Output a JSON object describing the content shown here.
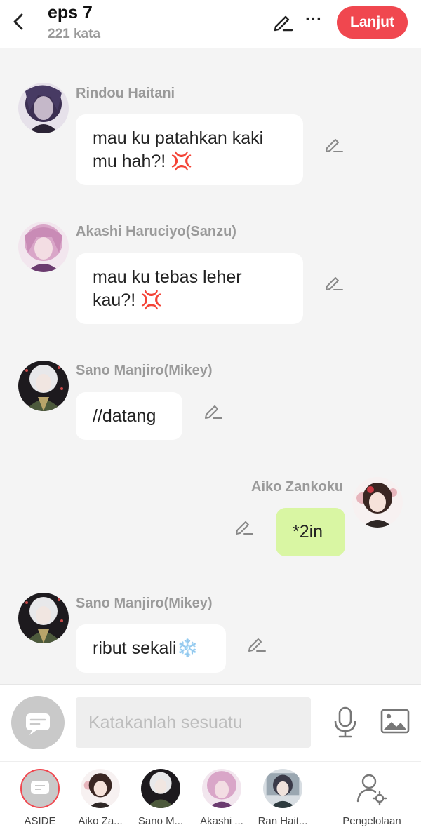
{
  "header": {
    "title": "eps 7",
    "word_count": "221 kata",
    "next_label": "Lanjut",
    "more_label": "···",
    "accent": "#f0474f"
  },
  "messages": [
    {
      "name": "Rindou Haitani",
      "text": "mau ku patahkan kaki mu hah?! 💢",
      "side": "left"
    },
    {
      "name": "Akashi Haruciyo(Sanzu)",
      "text": "mau ku tebas leher kau?! 💢",
      "side": "left"
    },
    {
      "name": "Sano Manjiro(Mikey)",
      "text": "//datang",
      "side": "left"
    },
    {
      "name": "Aiko Zankoku",
      "text": "*2in",
      "side": "right",
      "bubble_color": "#d9f6a3"
    },
    {
      "name": "Sano Manjiro(Mikey)",
      "text": "ribut sekali❄️",
      "side": "left"
    }
  ],
  "input": {
    "placeholder": "Katakanlah sesuatu"
  },
  "characters": [
    {
      "label": "ASIDE"
    },
    {
      "label": "Aiko Za..."
    },
    {
      "label": "Sano M..."
    },
    {
      "label": "Akashi ..."
    },
    {
      "label": "Ran Hait..."
    },
    {
      "label": "Pengelolaan"
    }
  ]
}
